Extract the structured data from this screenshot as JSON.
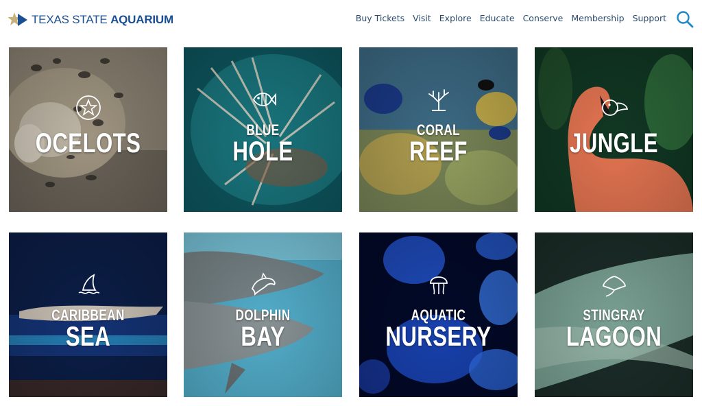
{
  "header": {
    "logo": {
      "text_regular": "TEXAS STATE",
      "text_bold": "AQUARIUM"
    },
    "nav": [
      "Buy Tickets",
      "Visit",
      "Explore",
      "Educate",
      "Conserve",
      "Membership",
      "Support"
    ],
    "search_icon": "search-icon"
  },
  "colors": {
    "brand_blue": "#1b4f93",
    "nav_text": "#2b4a6e",
    "search": "#1e88c9"
  },
  "tiles": [
    {
      "line1": "",
      "line2": "OCELOTS",
      "icon": "star-icon"
    },
    {
      "line1": "BLUE",
      "line2": "HOLE",
      "icon": "fish-icon"
    },
    {
      "line1": "CORAL",
      "line2": "REEF",
      "icon": "coral-icon"
    },
    {
      "line1": "",
      "line2": "JUNGLE",
      "icon": "toucan-icon"
    },
    {
      "line1": "CARIBBEAN",
      "line2": "SEA",
      "icon": "shark-fin-icon"
    },
    {
      "line1": "DOLPHIN",
      "line2": "BAY",
      "icon": "dolphin-icon"
    },
    {
      "line1": "AQUATIC",
      "line2": "NURSERY",
      "icon": "jellyfish-icon"
    },
    {
      "line1": "STINGRAY",
      "line2": "LAGOON",
      "icon": "stingray-icon"
    }
  ]
}
